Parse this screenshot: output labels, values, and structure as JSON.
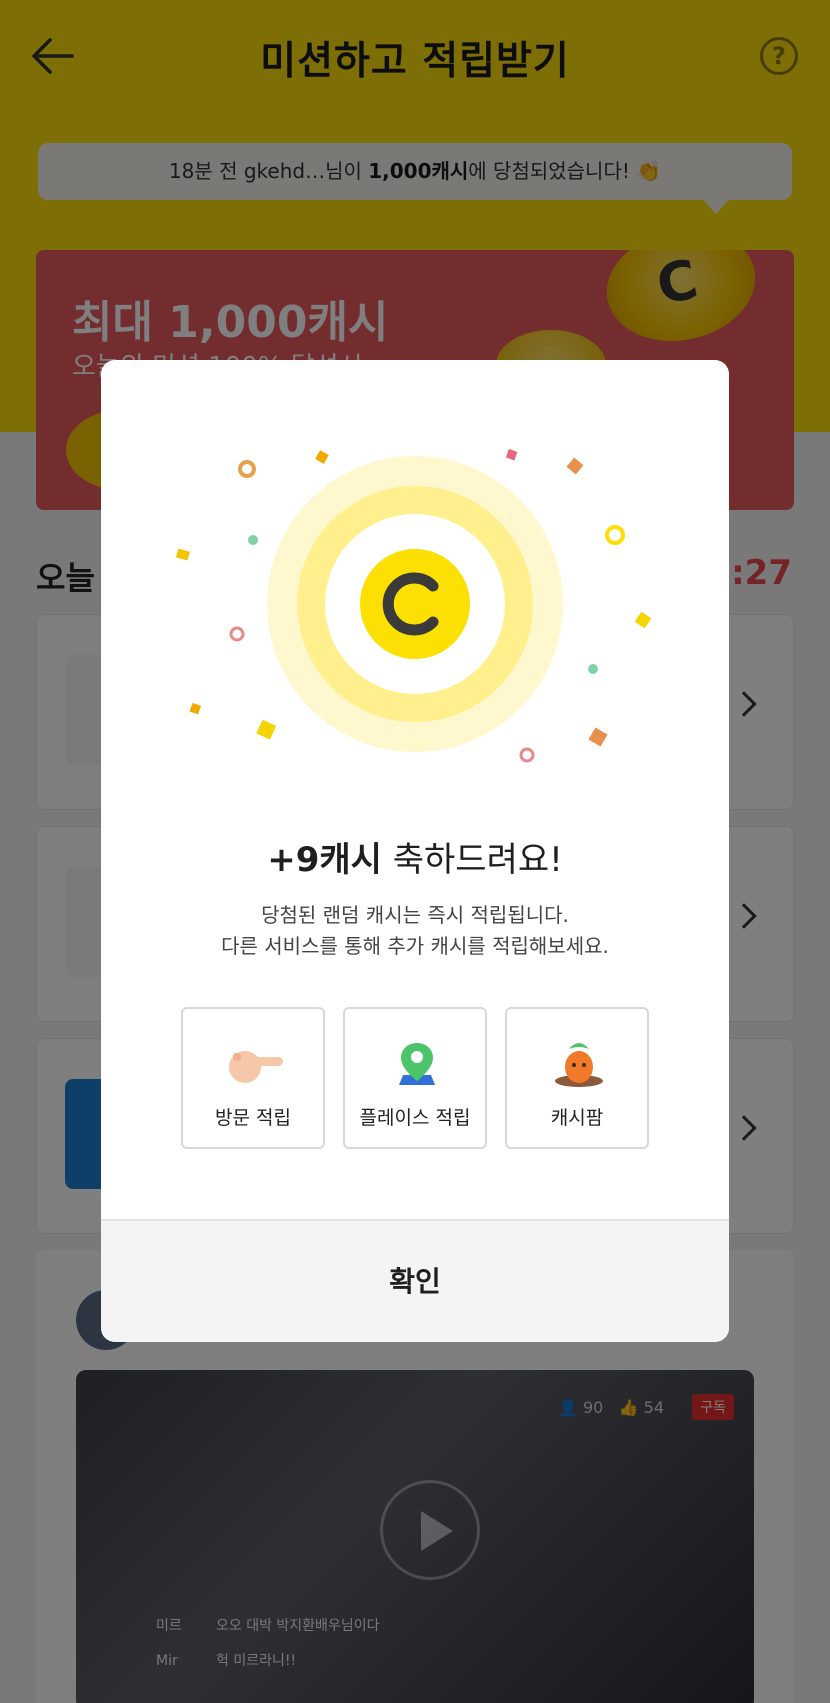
{
  "header": {
    "title": "미션하고 적립받기",
    "help_symbol": "?"
  },
  "ticker": {
    "prefix": "18분 전 gkehd…님이 ",
    "amount": "1,000캐시",
    "suffix": "에 당첨되었습니다! 👏"
  },
  "promo": {
    "title": "최대 1,000캐시",
    "subtitle": "오늘의 미션 100% 달성시"
  },
  "today": {
    "title": "오늘",
    "timer": "7:27"
  },
  "feed": {
    "viewers": "90",
    "likes": "54",
    "subscribe": "구독",
    "chat": [
      {
        "name": "미르",
        "message": "오오 대박 박지환배우님이다"
      },
      {
        "name": "Mir",
        "message": "헉 미르라니!!"
      }
    ]
  },
  "modal": {
    "reward_amount": "+9캐시",
    "reward_congrats": " 축하드려요!",
    "desc_line1": "당첨된 랜덤 캐시는 즉시 적립됩니다.",
    "desc_line2": "다른 서비스를 통해 추가 캐시를 적립해보세요.",
    "shortcuts": [
      {
        "label": "방문 적립",
        "icon": "pointing-hand-icon"
      },
      {
        "label": "플레이스 적립",
        "icon": "map-pin-icon"
      },
      {
        "label": "캐시팜",
        "icon": "carrot-icon"
      }
    ],
    "confirm_label": "확인"
  },
  "colors": {
    "brand_yellow": "#fbdc0b",
    "promo_red": "#e85a5e",
    "timer_red": "#e8474c",
    "coin_yellow": "#fde003"
  }
}
